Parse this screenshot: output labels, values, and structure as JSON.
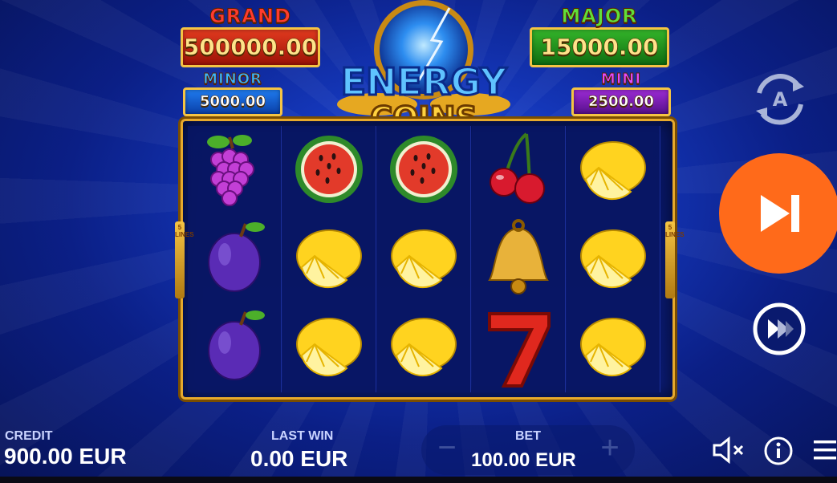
{
  "jackpots": {
    "grand": {
      "title": "GRAND",
      "value": "500000.00"
    },
    "major": {
      "title": "MAJOR",
      "value": "15000.00"
    },
    "minor": {
      "title": "MINOR",
      "value": "5000.00"
    },
    "mini": {
      "title": "MINI",
      "value": "2500.00"
    }
  },
  "logo": {
    "line1": "ENERGY",
    "line2": "COINS"
  },
  "lines_label": {
    "left": "5 LINES",
    "right": "5 LINES"
  },
  "reels": [
    [
      "grapes",
      "plum",
      "plum"
    ],
    [
      "watermelon",
      "lemon",
      "lemon"
    ],
    [
      "watermelon",
      "lemon",
      "lemon"
    ],
    [
      "cherries",
      "bell",
      "seven"
    ],
    [
      "lemon",
      "lemon",
      "lemon"
    ]
  ],
  "controls": {
    "autoplay_icon": "autoplay-a-icon",
    "spin_icon": "play-skip-icon",
    "turbo_icon": "fast-forward-icon",
    "spin_color": "#ff6a1a"
  },
  "bottom": {
    "credit_label": "CREDIT",
    "credit_value": "900.00 EUR",
    "last_win_label": "LAST WIN",
    "last_win_value": "0.00 EUR",
    "bet_label": "BET",
    "bet_value": "100.00 EUR",
    "minus": "−",
    "plus": "+",
    "sound_icon": "speaker-muted-icon",
    "info_icon": "info-icon",
    "menu_icon": "hamburger-menu-icon"
  }
}
